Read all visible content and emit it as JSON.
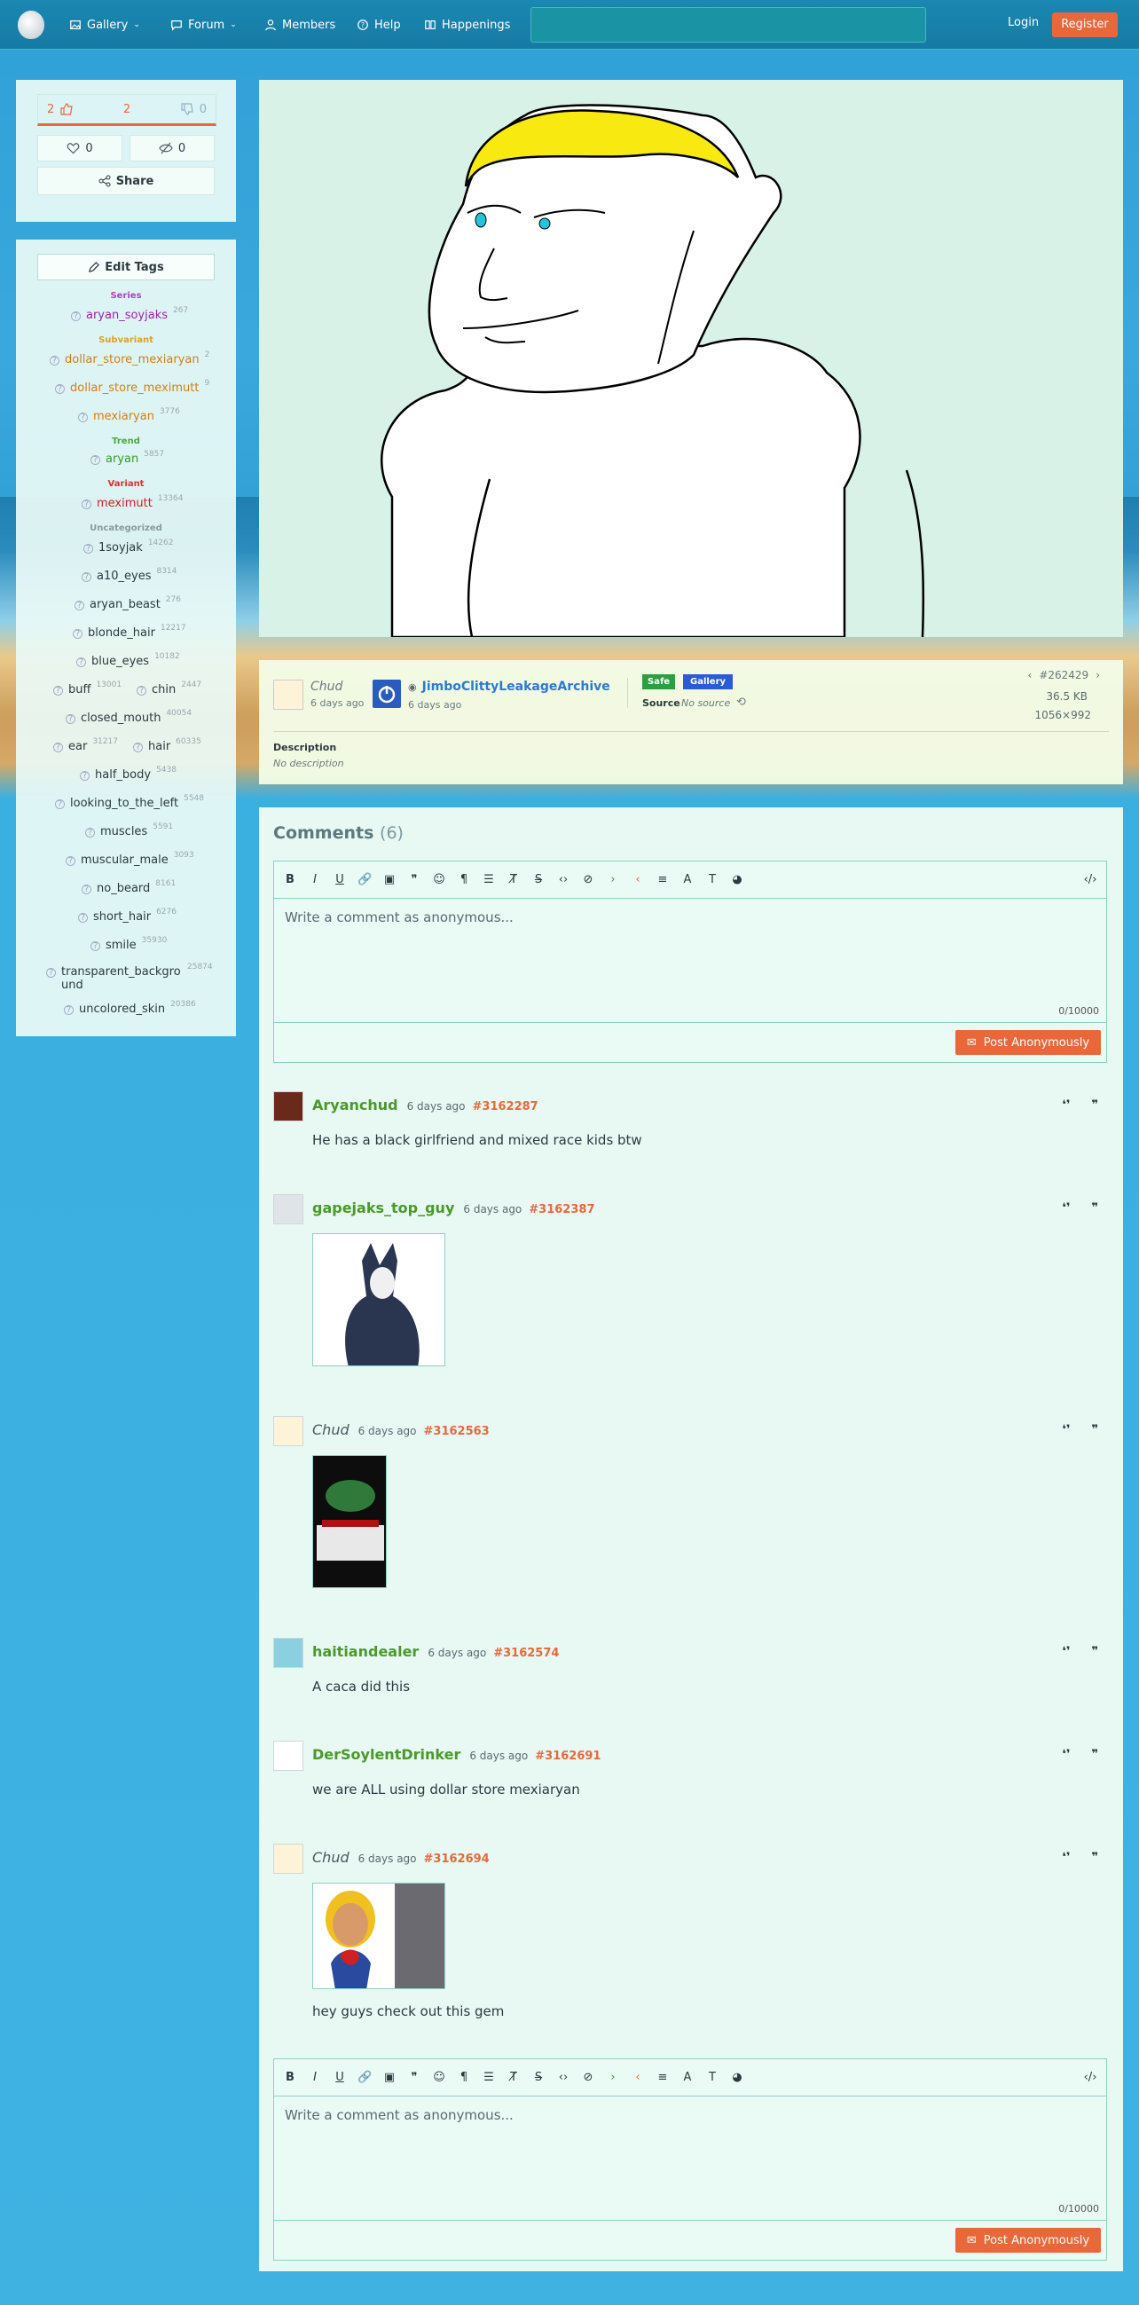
{
  "nav": {
    "items": [
      {
        "label": "Gallery"
      },
      {
        "label": "Forum"
      },
      {
        "label": "Members"
      },
      {
        "label": "Help"
      },
      {
        "label": "Happenings"
      }
    ],
    "login": "Login",
    "register": "Register"
  },
  "votes": {
    "up": "2",
    "score": "2",
    "down": "0",
    "favorites": "0",
    "hidden": "0",
    "share": "Share"
  },
  "tags": {
    "edit_label": "Edit Tags",
    "sections": {
      "series": "Series",
      "subvariant": "Subvariant",
      "trend": "Trend",
      "variant": "Variant",
      "uncategorized": "Uncategorized"
    },
    "items": [
      {
        "name": "aryan_soyjaks",
        "count": "267"
      },
      {
        "name": "dollar_store_mexiaryan",
        "count": "2"
      },
      {
        "name": "dollar_store_meximutt",
        "count": "9"
      },
      {
        "name": "mexiaryan",
        "count": "3776"
      },
      {
        "name": "aryan",
        "count": "5857"
      },
      {
        "name": "meximutt",
        "count": "13364"
      },
      {
        "name": "1soyjak",
        "count": "14262"
      },
      {
        "name": "a10_eyes",
        "count": "8314"
      },
      {
        "name": "aryan_beast",
        "count": "276"
      },
      {
        "name": "blonde_hair",
        "count": "12217"
      },
      {
        "name": "blue_eyes",
        "count": "10182"
      },
      {
        "name": "buff",
        "count": "13001"
      },
      {
        "name": "chin",
        "count": "2447"
      },
      {
        "name": "closed_mouth",
        "count": "40054"
      },
      {
        "name": "ear",
        "count": "31217"
      },
      {
        "name": "hair",
        "count": "60335"
      },
      {
        "name": "half_body",
        "count": "5438"
      },
      {
        "name": "looking_to_the_left",
        "count": "5548"
      },
      {
        "name": "muscles",
        "count": "5591"
      },
      {
        "name": "muscular_male",
        "count": "3093"
      },
      {
        "name": "no_beard",
        "count": "8161"
      },
      {
        "name": "short_hair",
        "count": "6276"
      },
      {
        "name": "smile",
        "count": "35930"
      },
      {
        "name": "transparent_background",
        "count": "25874"
      },
      {
        "name": "uncolored_skin",
        "count": "20386"
      }
    ]
  },
  "post": {
    "uploader": "Chud",
    "uploader_time": "6 days ago",
    "approver": "JimboClittyLeakageArchive",
    "approver_time": "6 days ago",
    "badge_safe": "Safe",
    "badge_gallery": "Gallery",
    "source_label": "Source",
    "source_value": "No source",
    "id": "#262429",
    "size": "36.5 KB",
    "dimensions": "1056×992",
    "description_label": "Description",
    "description_value": "No description"
  },
  "comments": {
    "title": "Comments",
    "count": "(6)",
    "placeholder": "Write a comment as anonymous...",
    "charcount": "0/10000",
    "post_button": "Post Anonymously",
    "list": [
      {
        "user": "Aryanchud",
        "time": "6 days ago",
        "id": "#3162287",
        "text": "He has a black girlfriend and mixed race kids btw"
      },
      {
        "user": "gapejaks_top_guy",
        "time": "6 days ago",
        "id": "#3162387",
        "text": ""
      },
      {
        "user": "Chud",
        "time": "6 days ago",
        "id": "#3162563",
        "text": ""
      },
      {
        "user": "haitiandealer",
        "time": "6 days ago",
        "id": "#3162574",
        "text": "A caca did this"
      },
      {
        "user": "DerSoylentDrinker",
        "time": "6 days ago",
        "id": "#3162691",
        "text": "we are ALL using dollar store mexiaryan"
      },
      {
        "user": "Chud",
        "time": "6 days ago",
        "id": "#3162694",
        "text": "hey guys check out this gem"
      }
    ]
  },
  "colors": {
    "accent": "#e9683a",
    "nav_bg": "#167aa3",
    "panel_bg": "#e8f8f3",
    "username": "#4a9a2a"
  }
}
